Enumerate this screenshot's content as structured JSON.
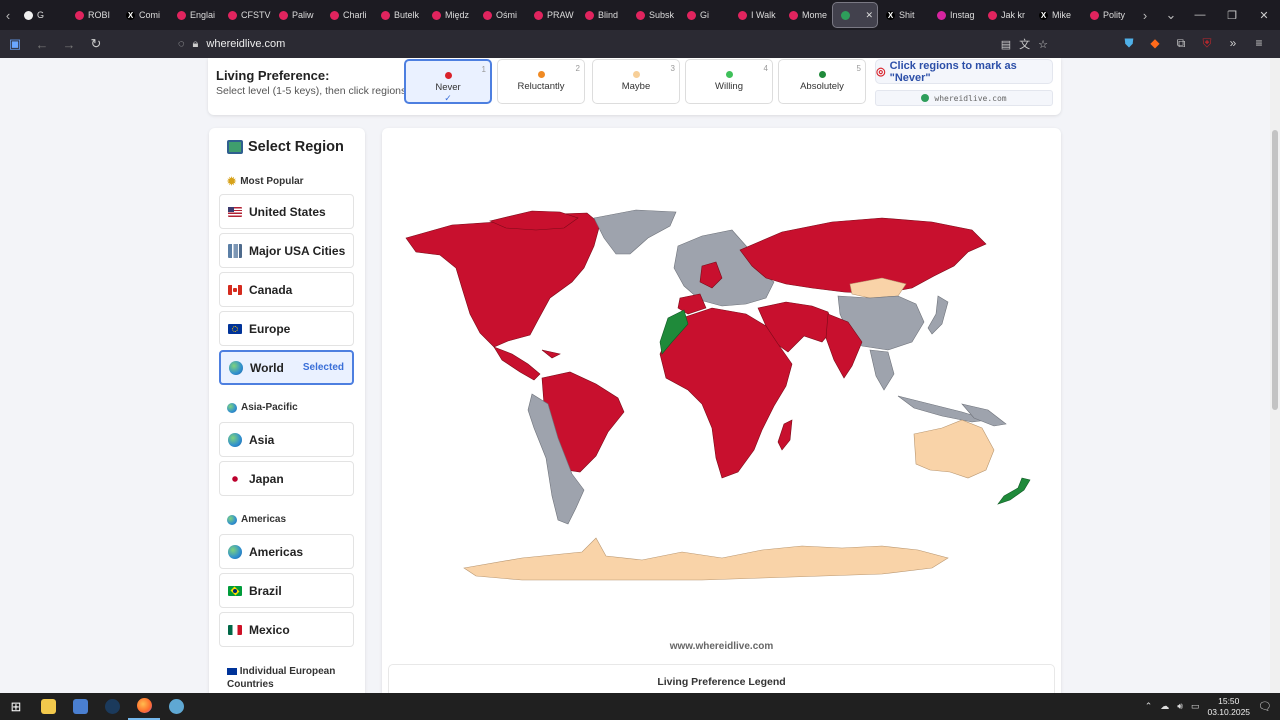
{
  "browser": {
    "tabs": [
      {
        "label": "G",
        "favicon": "#f0f0f0",
        "favicon_glyph": ""
      },
      {
        "label": "ROBI",
        "favicon": "#e0245e",
        "favicon_glyph": ""
      },
      {
        "label": "Comi",
        "favicon": "#000000",
        "favicon_glyph": "X"
      },
      {
        "label": "Englai",
        "favicon": "#e0245e",
        "favicon_glyph": ""
      },
      {
        "label": "CFSTV",
        "favicon": "#e0245e",
        "favicon_glyph": ""
      },
      {
        "label": "Paliw",
        "favicon": "#e0245e",
        "favicon_glyph": ""
      },
      {
        "label": "Charli",
        "favicon": "#e0245e",
        "favicon_glyph": ""
      },
      {
        "label": "Butelk",
        "favicon": "#e0245e",
        "favicon_glyph": ""
      },
      {
        "label": "Międz",
        "favicon": "#e0245e",
        "favicon_glyph": ""
      },
      {
        "label": "Ośmi",
        "favicon": "#e0245e",
        "favicon_glyph": ""
      },
      {
        "label": "PRAW",
        "favicon": "#e0245e",
        "favicon_glyph": ""
      },
      {
        "label": "Blind",
        "favicon": "#e0245e",
        "favicon_glyph": ""
      },
      {
        "label": "Subsk",
        "favicon": "#e0245e",
        "favicon_glyph": ""
      },
      {
        "label": "Gi",
        "favicon": "#e0245e",
        "favicon_glyph": ""
      },
      {
        "label": "I Walk",
        "favicon": "#e0245e",
        "favicon_glyph": ""
      },
      {
        "label": "Mome",
        "favicon": "#e0245e",
        "favicon_glyph": ""
      },
      {
        "label": "",
        "favicon": "#2e9e5b",
        "favicon_glyph": "",
        "active": true
      },
      {
        "label": "Shit",
        "favicon": "#000000",
        "favicon_glyph": "X"
      },
      {
        "label": "Instag",
        "favicon": "#d6249f",
        "favicon_glyph": ""
      },
      {
        "label": "Jak kr",
        "favicon": "#e0245e",
        "favicon_glyph": ""
      },
      {
        "label": "Mike",
        "favicon": "#000000",
        "favicon_glyph": "X"
      },
      {
        "label": "Polity",
        "favicon": "#e0245e",
        "favicon_glyph": ""
      }
    ],
    "url": "whereidlive.com"
  },
  "preference": {
    "title": "Living Preference:",
    "subtitle": "Select level (1-5 keys), then click regions",
    "levels": [
      {
        "key": "1",
        "name": "Never",
        "color": "#d9222a",
        "selected": true,
        "check": "✓"
      },
      {
        "key": "2",
        "name": "Reluctantly",
        "color": "#f08a24",
        "selected": false,
        "check": ""
      },
      {
        "key": "3",
        "name": "Maybe",
        "color": "#f7cf98",
        "selected": false,
        "check": ""
      },
      {
        "key": "4",
        "name": "Willing",
        "color": "#3fc05a",
        "selected": false,
        "check": ""
      },
      {
        "key": "5",
        "name": "Absolutely",
        "color": "#1f8a3a",
        "selected": false,
        "check": ""
      }
    ],
    "hint": "Click regions to mark as \"Never\"",
    "domain": "whereidlive.com"
  },
  "sidebar": {
    "title": "Select Region",
    "sections": [
      {
        "title": "Most Popular",
        "icon": "star-icon"
      },
      {
        "title": "Asia-Pacific",
        "icon": "globe-icon"
      },
      {
        "title": "Americas",
        "icon": "globe-icon"
      },
      {
        "title": "Individual European Countries",
        "icon": "eu-flag-icon"
      }
    ],
    "items": [
      {
        "label": "United States",
        "icon": "us-flag"
      },
      {
        "label": "Major USA Cities",
        "icon": "city-icon"
      },
      {
        "label": "Canada",
        "icon": "canada-flag"
      },
      {
        "label": "Europe",
        "icon": "eu-flag"
      },
      {
        "label": "World",
        "icon": "globe",
        "selected": true,
        "tag": "Selected"
      },
      {
        "label": "Asia",
        "icon": "globe"
      },
      {
        "label": "Japan",
        "icon": "japan-flag"
      },
      {
        "label": "Americas",
        "icon": "globe"
      },
      {
        "label": "Brazil",
        "icon": "brazil-flag"
      },
      {
        "label": "Mexico",
        "icon": "mexico-flag"
      }
    ]
  },
  "map": {
    "watermark": "www.whereidlive.com",
    "legend_title": "Living Preference Legend",
    "colors": {
      "never": "#c8102e",
      "maybe": "#f9d3a8",
      "absolutely": "#1f8a3a",
      "unset": "#9ea3ad"
    }
  },
  "taskbar": {
    "time": "15:50",
    "date": "03.10.2025"
  }
}
